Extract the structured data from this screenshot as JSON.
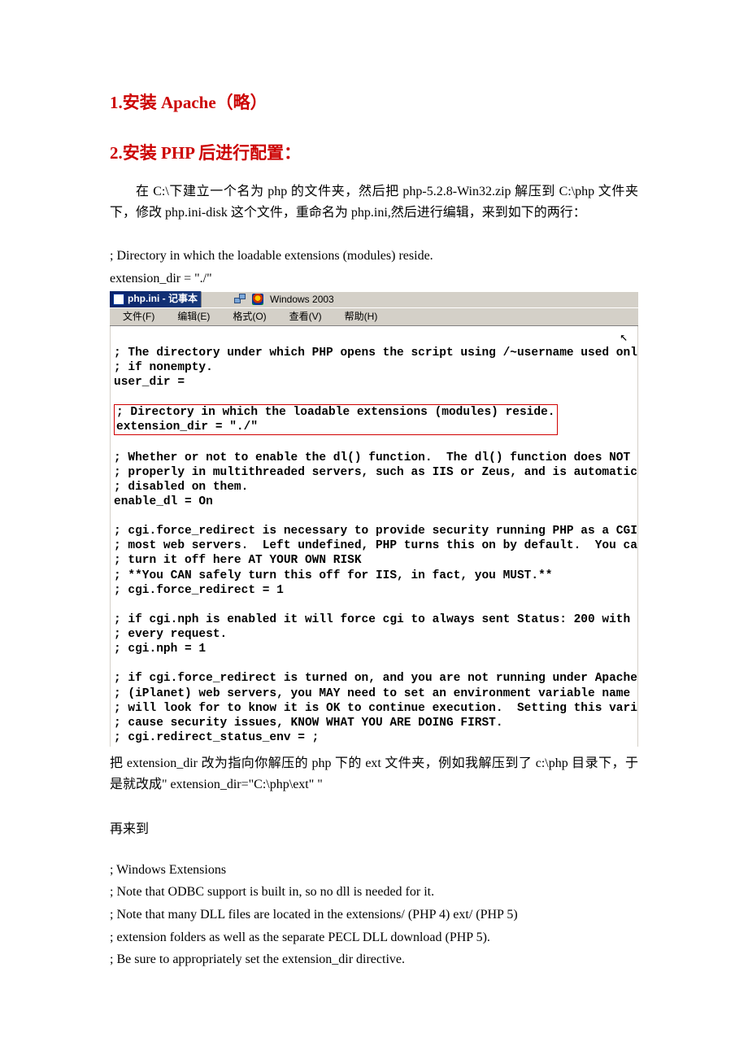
{
  "h1": "1.安装 Apache（略）",
  "h2": "2.安装 PHP 后进行配置：",
  "para1": "在 C:\\下建立一个名为 php 的文件夹，然后把 php-5.2.8-Win32.zip 解压到 C:\\php 文件夹下，修改 php.ini-disk 这个文件，重命名为 php.ini,然后进行编辑，来到如下的两行：",
  "code_pre_1": "; Directory in which the loadable extensions (modules) reside.",
  "code_pre_2": "extension_dir = \"./\"",
  "notepad": {
    "title": "php.ini - 记事本",
    "tray": "Windows 2003",
    "cursor": "↖",
    "menu": {
      "file": "文件(F)",
      "edit": "编辑(E)",
      "format": "格式(O)",
      "view": "查看(V)",
      "help": "帮助(H)"
    },
    "pre_block": "\n; The directory under which PHP opens the script using /~username used only\n; if nonempty.\nuser_dir =\n",
    "hl_block": "; Directory in which the loadable extensions (modules) reside.\nextension_dir = \"./\"",
    "post_block": "\n; Whether or not to enable the dl() function.  The dl() function does NOT work\n; properly in multithreaded servers, such as IIS or Zeus, and is automatically\n; disabled on them.\nenable_dl = On\n\n; cgi.force_redirect is necessary to provide security running PHP as a CGI unde\n; most web servers.  Left undefined, PHP turns this on by default.  You can\n; turn it off here AT YOUR OWN RISK\n; **You CAN safely turn this off for IIS, in fact, you MUST.**\n; cgi.force_redirect = 1\n\n; if cgi.nph is enabled it will force cgi to always sent Status: 200 with\n; every request.\n; cgi.nph = 1\n\n; if cgi.force_redirect is turned on, and you are not running under Apache or N\n; (iPlanet) web servers, you MAY need to set an environment variable name that\n; will look for to know it is OK to continue execution.  Setting this variable\n; cause security issues, KNOW WHAT YOU ARE DOING FIRST.\n; cgi.redirect_status_env = ;"
  },
  "para2": "把 extension_dir 改为指向你解压的 php 下的 ext 文件夹，例如我解压到了 c:\\php  目录下，于是就改成\" extension_dir=\"C:\\php\\ext\" \"",
  "para3": "再来到",
  "ext_lines": {
    "l1": "; Windows Extensions",
    "l2": "; Note that ODBC support is built in, so no dll is needed for it.",
    "l3": "; Note that many DLL files are located in the extensions/ (PHP 4) ext/ (PHP 5)",
    "l4": "; extension folders as well as the separate PECL DLL download (PHP 5).",
    "l5": "; Be sure to appropriately set the extension_dir directive."
  }
}
